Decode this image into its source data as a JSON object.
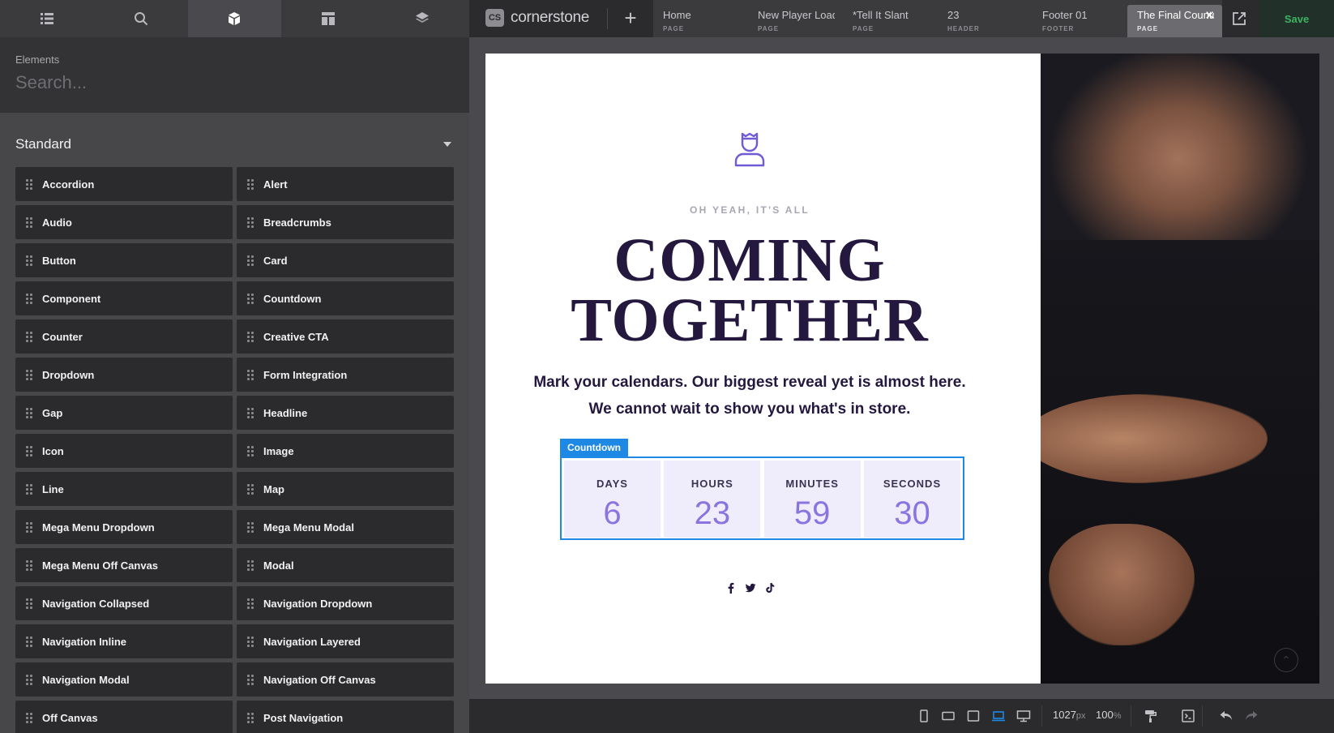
{
  "sidebar": {
    "tabs": [
      {
        "icon": "list-icon"
      },
      {
        "icon": "search-icon"
      },
      {
        "icon": "cube-icon",
        "active": true
      },
      {
        "icon": "layout-icon"
      },
      {
        "icon": "layers-icon"
      }
    ],
    "search_label": "Elements",
    "search_placeholder": "Search...",
    "section_title": "Standard",
    "elements": [
      "Accordion",
      "Alert",
      "Audio",
      "Breadcrumbs",
      "Button",
      "Card",
      "Component",
      "Countdown",
      "Counter",
      "Creative CTA",
      "Dropdown",
      "Form Integration",
      "Gap",
      "Headline",
      "Icon",
      "Image",
      "Line",
      "Map",
      "Mega Menu Dropdown",
      "Mega Menu Modal",
      "Mega Menu Off Canvas",
      "Modal",
      "Navigation Collapsed",
      "Navigation Dropdown",
      "Navigation Inline",
      "Navigation Layered",
      "Navigation Modal",
      "Navigation Off Canvas",
      "Off Canvas",
      "Post Navigation"
    ]
  },
  "topbar": {
    "logo_badge": "CS",
    "logo_text": "cornerstone",
    "tabs": [
      {
        "name": "Home",
        "kind": "PAGE"
      },
      {
        "name": "New Player Loading",
        "kind": "PAGE"
      },
      {
        "name": "*Tell It Slant",
        "kind": "PAGE"
      },
      {
        "name": "23",
        "kind": "HEADER"
      },
      {
        "name": "Footer 01",
        "kind": "FOOTER"
      },
      {
        "name": "The Final Countdown",
        "kind": "PAGE",
        "active": true
      }
    ],
    "save_label": "Save",
    "save_color": "#3bb360"
  },
  "preview": {
    "kicker": "OH YEAH, IT'S ALL",
    "headline_line1": "COMING",
    "headline_line2": "TOGETHER",
    "subtext_line1": "Mark your calendars. Our biggest reveal yet is almost here.",
    "subtext_line2": "We cannot wait to show you what's in store.",
    "countdown_label": "Countdown",
    "countdown": [
      {
        "unit": "DAYS",
        "value": "6"
      },
      {
        "unit": "HOURS",
        "value": "23"
      },
      {
        "unit": "MINUTES",
        "value": "59"
      },
      {
        "unit": "SECONDS",
        "value": "30"
      }
    ],
    "social": [
      "facebook-icon",
      "twitter-icon",
      "tiktok-icon"
    ],
    "accent_color": "#8a74e0",
    "heading_color": "#24183f",
    "selection_color": "#1e88e5"
  },
  "bottombar": {
    "width_value": "1027",
    "width_unit": "px",
    "zoom_value": "100",
    "zoom_unit": "%"
  }
}
